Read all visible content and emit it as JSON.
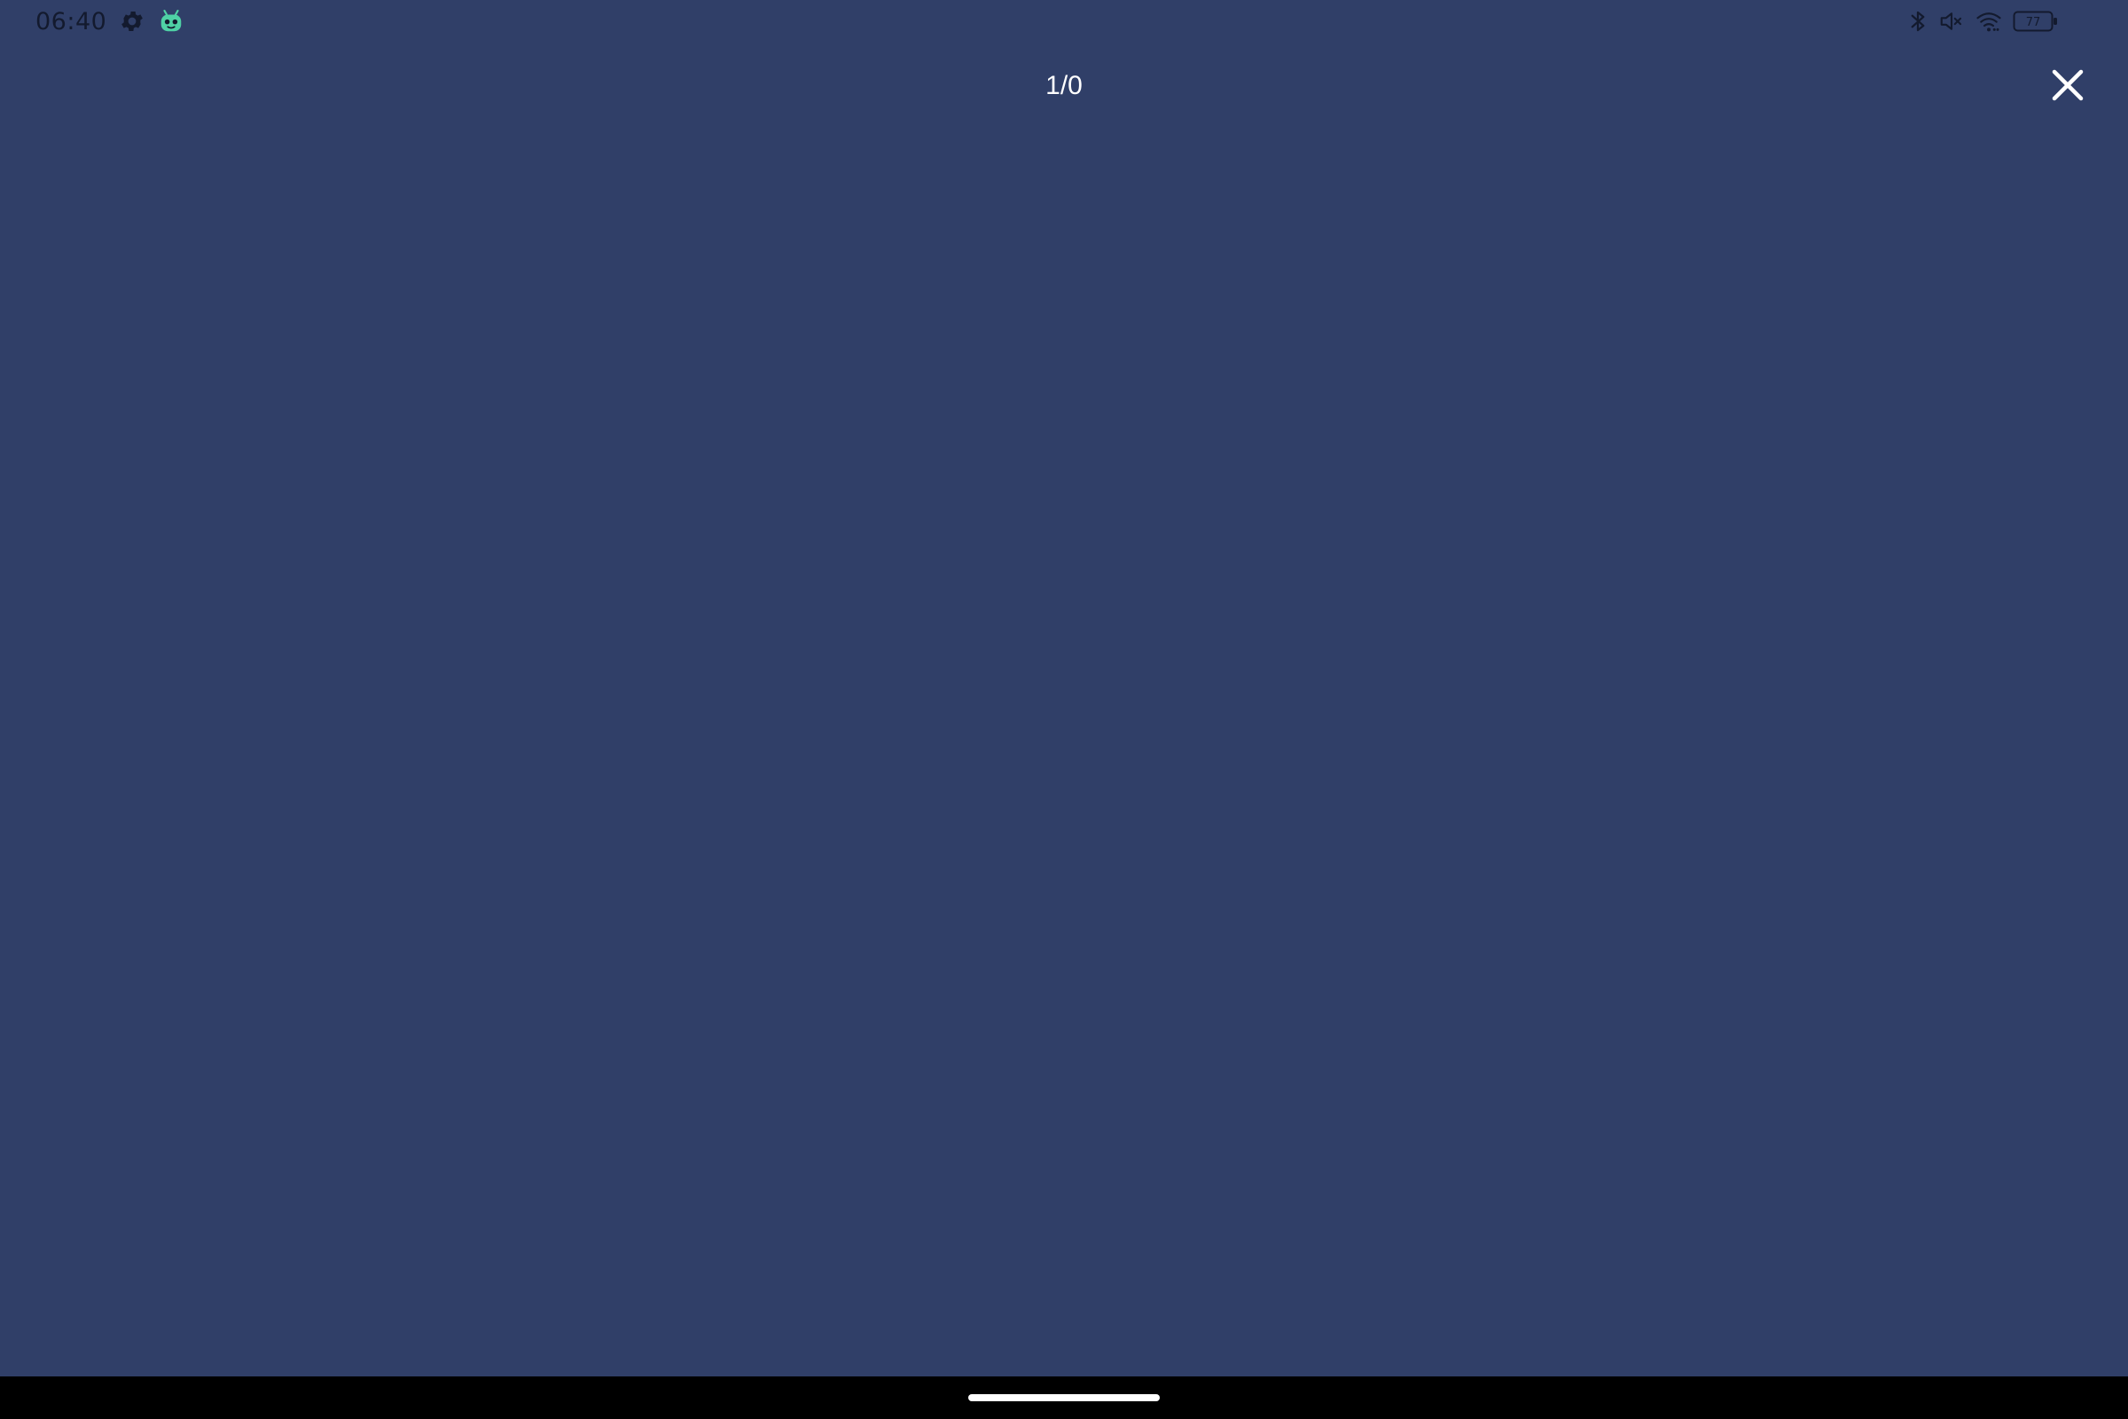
{
  "status_bar": {
    "time": "06:40",
    "left_icons": [
      "gear-icon",
      "android-robot-icon"
    ],
    "right_icons": [
      "bluetooth-icon",
      "volume-mute-icon",
      "wifi-icon",
      "battery-icon"
    ],
    "battery_level": "77"
  },
  "viewer": {
    "page_counter": "1/0",
    "close_icon": "close-icon"
  },
  "colors": {
    "background": "#303f68",
    "status_text": "#131a2e",
    "foreground": "#ffffff",
    "robot_accent": "#4fd1a5",
    "nav_bar": "#000000"
  }
}
